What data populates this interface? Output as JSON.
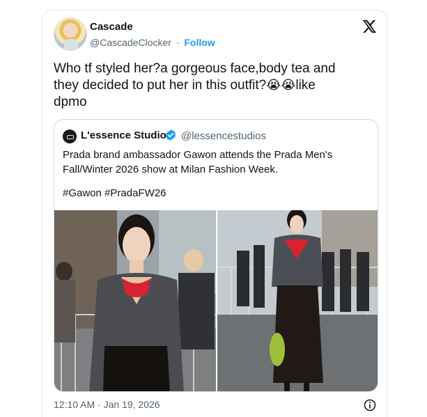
{
  "tweet": {
    "author_name": "Cascade",
    "author_handle": "@CascadeClocker",
    "separator": "·",
    "follow_label": "Follow",
    "text_line1": "Who tf styled her?a gorgeous face,body tea and",
    "text_line2_a": "they decided to put her in this outfit?",
    "emoji": "😭",
    "text_line2_b": "like",
    "text_line3": "dpmo",
    "timestamp": "12:10 AM · Jan 19, 2026",
    "logo_icon": "x-logo-icon",
    "info_icon": "info-icon"
  },
  "quote": {
    "author_name": "L'essence Studios",
    "author_handle": "@lessencestudios",
    "verified_icon": "verified-badge-icon",
    "text_line1": "Prada brand ambassador Gawon attends the Prada Men's",
    "text_line2": "Fall/Winter 2026 show at Milan Fashion Week.",
    "hashtags": "#Gawon #PradaFW26",
    "photos": [
      "photo-left",
      "photo-right"
    ]
  },
  "colors": {
    "accent": "#1d9bf0",
    "text": "#0f1419",
    "secondary": "#536471",
    "border": "#cfd9de"
  }
}
